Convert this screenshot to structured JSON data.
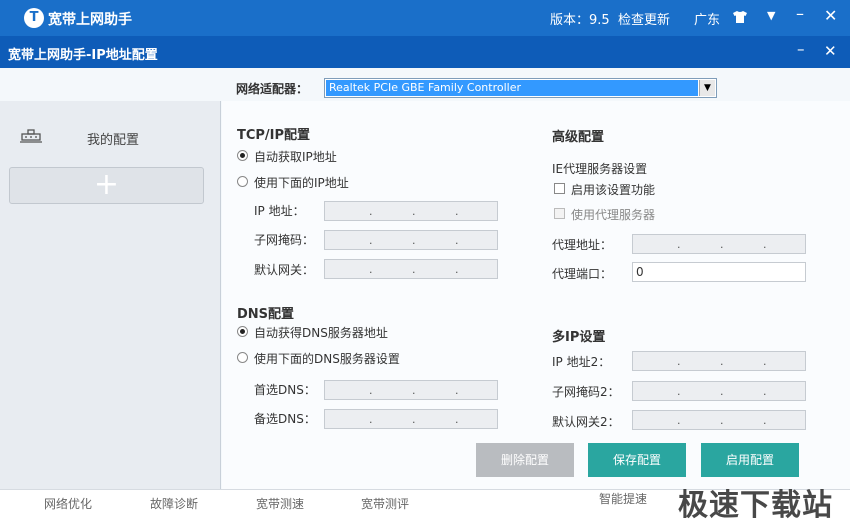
{
  "app": {
    "logo_letter": "T",
    "title": "宽带上网助手",
    "version": "版本：9.5",
    "check_update": "检查更新",
    "region": "广东"
  },
  "dialog": {
    "title": "宽带上网助手-IP地址配置"
  },
  "adapter": {
    "label": "网络适配器：",
    "selected": "Realtek PCIe GBE Family Controller"
  },
  "sidebar": {
    "my_config": "我的配置",
    "add_symbol": "+"
  },
  "tcpip": {
    "title": "TCP/IP配置",
    "auto_ip": "自动获取IP地址",
    "manual_ip": "使用下面的IP地址",
    "ip_label": "IP 地址：",
    "mask_label": "子网掩码：",
    "gateway_label": "默认网关："
  },
  "dns": {
    "title": "DNS配置",
    "auto_dns": "自动获得DNS服务器地址",
    "manual_dns": "使用下面的DNS服务器设置",
    "primary_label": "首选DNS：",
    "secondary_label": "备选DNS："
  },
  "advanced": {
    "title": "高级配置",
    "ie_proxy_title": "IE代理服务器设置",
    "enable_setting": "启用该设置功能",
    "use_proxy": "使用代理服务器",
    "proxy_addr_label": "代理地址：",
    "proxy_port_label": "代理端口：",
    "proxy_port_value": "0"
  },
  "multi_ip": {
    "title": "多IP设置",
    "ip2_label": "IP 地址2：",
    "mask2_label": "子网掩码2：",
    "gateway2_label": "默认网关2："
  },
  "buttons": {
    "delete": "删除配置",
    "save": "保存配置",
    "enable": "启用配置"
  },
  "bottom_nav": [
    "网络优化",
    "故障诊断",
    "宽带测速",
    "宽带测评",
    "智能提速"
  ],
  "watermark": "极速下载站",
  "colors": {
    "title_bar": "#1a6fc9",
    "dialog_bar": "#0e5cb8",
    "accent_teal": "#2aa6a0",
    "disabled_button": "#b9bcc0"
  }
}
